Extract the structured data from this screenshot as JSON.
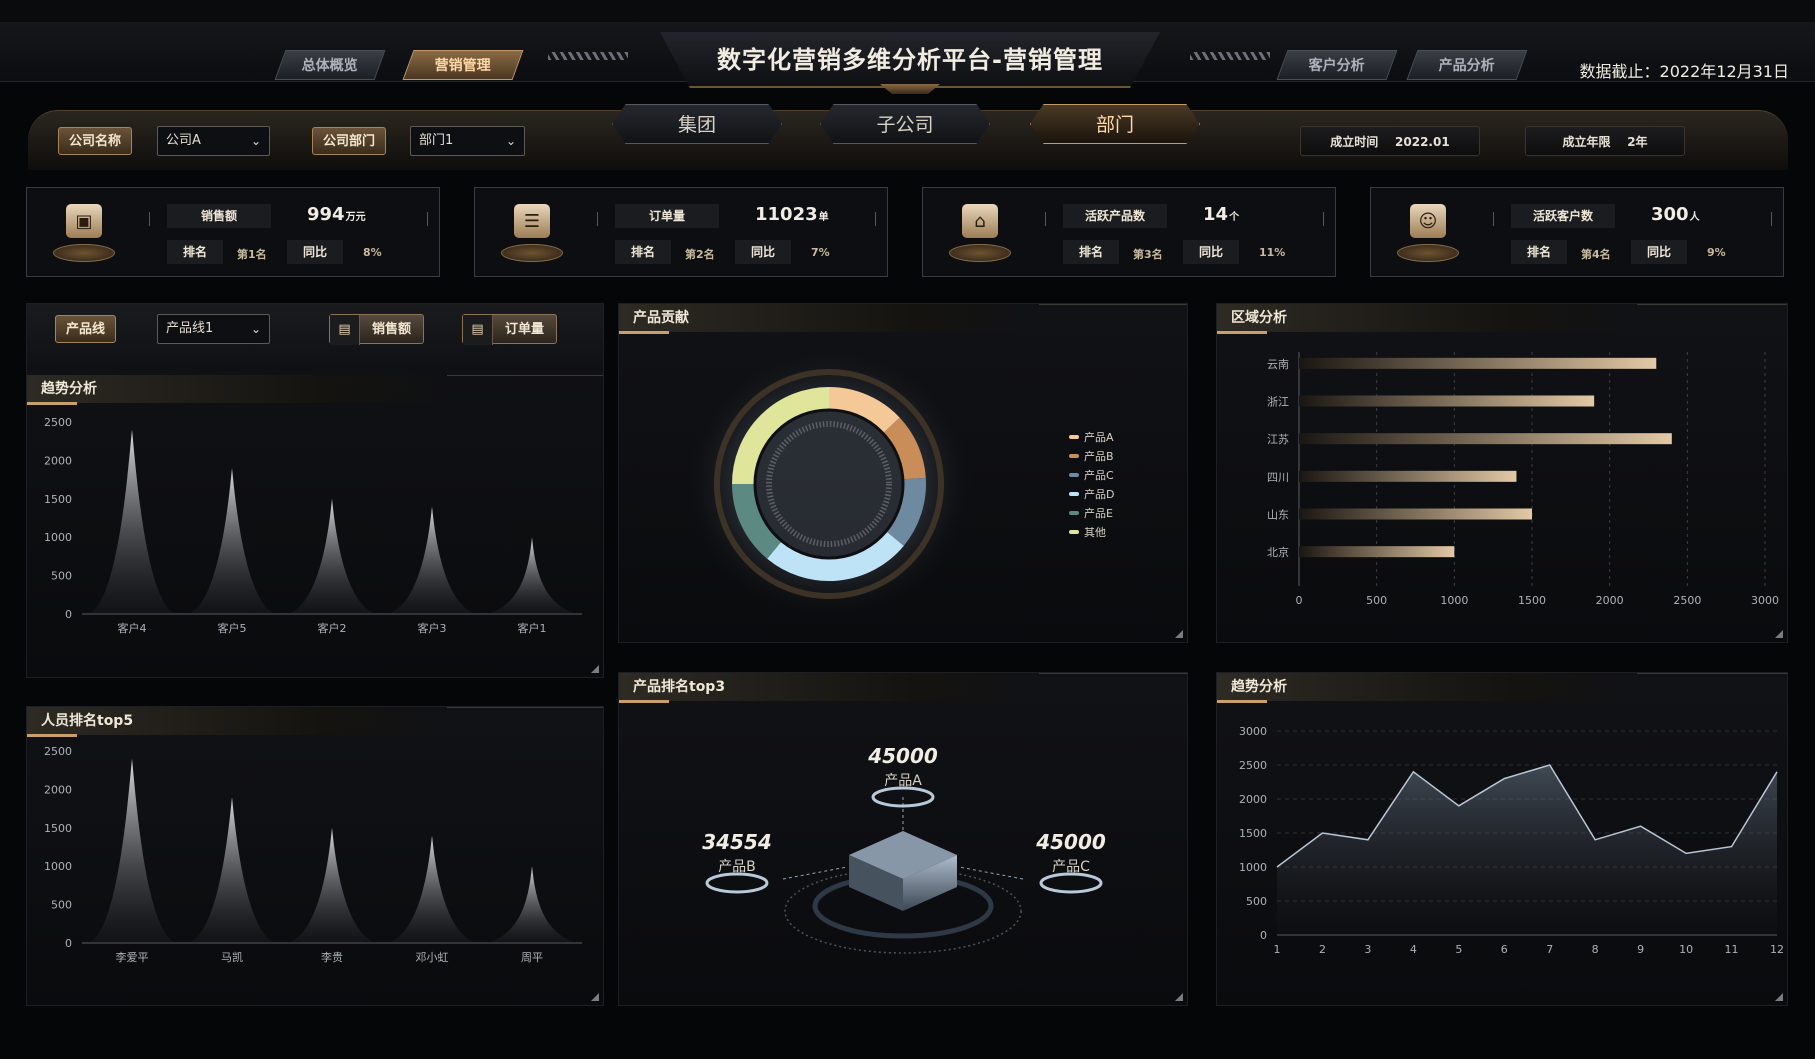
{
  "header": {
    "title": "数字化营销多维分析平台-营销管理",
    "left_tabs": [
      {
        "label": "总体概览",
        "active": false
      },
      {
        "label": "营销管理",
        "active": true
      }
    ],
    "right_tabs": [
      {
        "label": "客户分析",
        "active": false
      },
      {
        "label": "产品分析",
        "active": false
      }
    ],
    "date_label": "数据截止：2022年12月31日"
  },
  "filters": {
    "company_label": "公司名称",
    "company_value": "公司A",
    "dept_label": "公司部门",
    "dept_value": "部门1",
    "segments": [
      {
        "label": "集团",
        "active": false
      },
      {
        "label": "子公司",
        "active": false
      },
      {
        "label": "部门",
        "active": true
      }
    ],
    "established_label": "成立时间",
    "established_value": "2022.01",
    "years_label": "成立年限",
    "years_value": "2年"
  },
  "kpis": [
    {
      "icon": "chart-card-icon",
      "label": "销售额",
      "value": "994",
      "unit": "万元",
      "rank_label": "排名",
      "rank": "第1名",
      "yoy_label": "同比",
      "yoy": "8%"
    },
    {
      "icon": "document-icon",
      "label": "订单量",
      "value": "11023",
      "unit": "单",
      "rank_label": "排名",
      "rank": "第2名",
      "yoy_label": "同比",
      "yoy": "7%"
    },
    {
      "icon": "cart-icon",
      "label": "活跃产品数",
      "value": "14",
      "unit": "个",
      "rank_label": "排名",
      "rank": "第3名",
      "yoy_label": "同比",
      "yoy": "11%"
    },
    {
      "icon": "user-add-icon",
      "label": "活跃客户数",
      "value": "300",
      "unit": "人",
      "rank_label": "排名",
      "rank": "第4名",
      "yoy_label": "同比",
      "yoy": "9%"
    }
  ],
  "product_filter": {
    "label": "产品线",
    "value": "产品线1",
    "sales_button": "销售额",
    "orders_button": "订单量"
  },
  "panels": {
    "trend_top": "趋势分析",
    "staff_rank": "人员排名top5",
    "contribution": "产品贡献",
    "top3": "产品排名top3",
    "region": "区域分析",
    "trend_right": "趋势分析"
  },
  "chart_data": [
    {
      "id": "customer-trend",
      "type": "area",
      "categories": [
        "客户4",
        "客户5",
        "客户2",
        "客户3",
        "客户1"
      ],
      "values": [
        2400,
        1900,
        1500,
        1400,
        1000
      ],
      "ylim": [
        0,
        2500
      ],
      "yticks": [
        0,
        500,
        1000,
        1500,
        2000,
        2500
      ]
    },
    {
      "id": "staff-rank",
      "type": "area",
      "categories": [
        "李爱平",
        "马凯",
        "李贵",
        "邓小虹",
        "周平"
      ],
      "values": [
        2400,
        1900,
        1500,
        1400,
        1000
      ],
      "ylim": [
        0,
        2500
      ],
      "yticks": [
        0,
        500,
        1000,
        1500,
        2000,
        2500
      ]
    },
    {
      "id": "product-contribution",
      "type": "pie",
      "labels": [
        "产品A",
        "产品B",
        "产品C",
        "产品D",
        "产品E",
        "其他"
      ],
      "values": [
        13,
        11,
        12,
        25,
        14,
        25
      ],
      "colors": [
        "#f4c897",
        "#c98d5a",
        "#6d8aa0",
        "#bfe3f6",
        "#5c8a82",
        "#dfe59a"
      ]
    },
    {
      "id": "region-analysis",
      "type": "bar",
      "orientation": "horizontal",
      "categories": [
        "云南",
        "浙江",
        "江苏",
        "四川",
        "山东",
        "北京"
      ],
      "values": [
        2300,
        1900,
        2400,
        1400,
        1500,
        1000
      ],
      "xlim": [
        0,
        3000
      ],
      "xticks": [
        0,
        500,
        1000,
        1500,
        2000,
        2500,
        3000
      ]
    },
    {
      "id": "monthly-trend",
      "type": "area",
      "x": [
        1,
        2,
        3,
        4,
        5,
        6,
        7,
        8,
        9,
        10,
        11,
        12
      ],
      "values": [
        1000,
        1500,
        1400,
        2400,
        1900,
        2300,
        2500,
        1400,
        1600,
        1200,
        1300,
        2400
      ],
      "ylim": [
        0,
        3000
      ],
      "yticks": [
        0,
        500,
        1000,
        1500,
        2000,
        2500,
        3000
      ]
    }
  ],
  "top3": [
    {
      "value": "45000",
      "name": "产品A"
    },
    {
      "value": "34554",
      "name": "产品B"
    },
    {
      "value": "45000",
      "name": "产品C"
    }
  ],
  "colors": {
    "accent": "#c9a06a",
    "panel_bg": "#0d0e11"
  }
}
